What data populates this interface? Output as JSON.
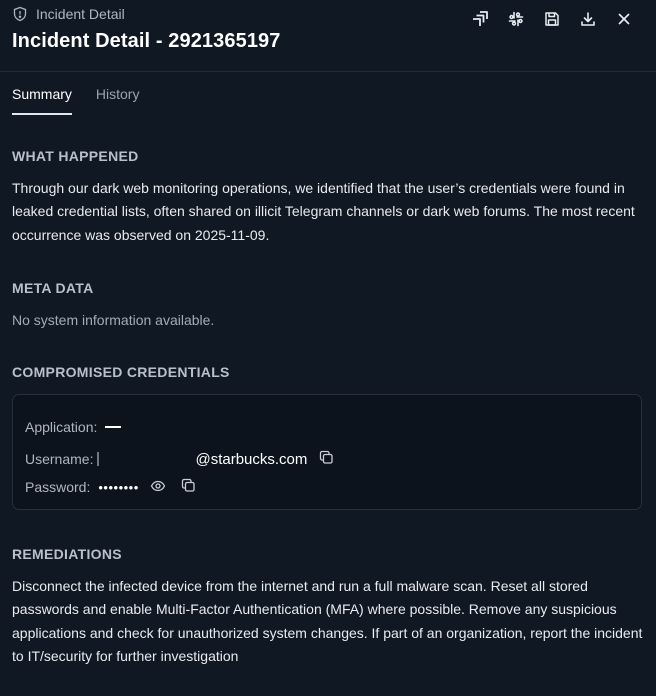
{
  "header": {
    "crumb": "Incident Detail",
    "title": "Incident Detail - 2921365197"
  },
  "toolbar": [
    {
      "name": "jira-icon"
    },
    {
      "name": "slack-icon"
    },
    {
      "name": "save-icon"
    },
    {
      "name": "download-icon"
    },
    {
      "name": "close-icon"
    }
  ],
  "tabs": [
    {
      "label": "Summary",
      "active": true
    },
    {
      "label": "History",
      "active": false
    }
  ],
  "sections": {
    "what_happened": {
      "title": "WHAT HAPPENED",
      "text": "Through our dark web monitoring operations, we identified that the user’s credentials were found in leaked credential lists, often shared on illicit Telegram channels or dark web forums. The most recent occurrence was observed on 2025-11-09."
    },
    "meta_data": {
      "title": "META DATA",
      "text": "No system information available."
    },
    "compromised": {
      "title": "COMPROMISED CREDENTIALS",
      "application_label": "Application:",
      "username_label": "Username:",
      "username_domain": "@starbucks.com",
      "password_label": "Password:",
      "password_mask": "••••••••"
    },
    "remediations": {
      "title": "REMEDIATIONS",
      "text": "Disconnect the infected device from the internet and run a full malware scan. Reset all stored passwords and enable Multi-Factor Authentication (MFA) where possible. Remove any suspicious applications and check for unauthorized system changes. If part of an organization, report the incident to IT/security for further investigation"
    }
  },
  "colors": {
    "background": "#101823",
    "card": "#0c131d",
    "text": "#e8ebef",
    "muted": "#a3abb6"
  }
}
